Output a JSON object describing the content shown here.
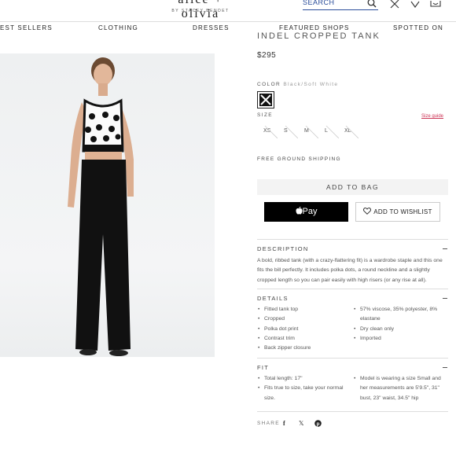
{
  "header": {
    "logo": "alice + olivia",
    "logo_sub": "BY STACEY BENDET",
    "search_placeholder": "SEARCH",
    "nav": [
      "EST SELLERS",
      "CLOTHING",
      "DRESSES",
      "FEATURED SHOPS",
      "SPOTTED ON"
    ]
  },
  "product": {
    "title": "INDEL CROPPED TANK",
    "price": "$295",
    "color_label": "COLOR",
    "color_value": "Black/Soft White",
    "size_label": "SIZE",
    "size_guide": "Size guide",
    "sizes": [
      "XS",
      "S",
      "M",
      "L",
      "XL"
    ],
    "shipping": "FREE GROUND SHIPPING",
    "add_to_bag": "ADD TO BAG",
    "apple_pay": "Pay",
    "wishlist": "ADD TO WISHLIST"
  },
  "description": {
    "heading": "DESCRIPTION",
    "text": "A bold, ribbed tank (with a crazy-flattering fit) is a wardrobe staple and this one fits the bill perfectly. It includes polka dots, a round neckline and a slightly cropped length so you can pair easily with high risers (or any rise at all)."
  },
  "details": {
    "heading": "DETAILS",
    "left": [
      "Fitted tank top",
      "Cropped",
      "Polka dot print",
      "Contrast trim",
      "Back zipper closure"
    ],
    "right": [
      "57% viscose, 35% polyester, 8% elastane",
      "Dry clean only",
      "Imported"
    ]
  },
  "fit": {
    "heading": "FIT",
    "left": [
      "Total length: 17\"",
      "Fits true to size, take your normal size."
    ],
    "right": [
      "Model is wearing a size Small and her measurements are 5'9.5\", 31\" bust, 23\" waist, 34.5\" hip"
    ]
  },
  "share": {
    "label": "SHARE",
    "icons": [
      "facebook-icon",
      "x-icon",
      "pinterest-icon"
    ]
  },
  "colors": {
    "accent_link": "#cc3355",
    "search_blue": "#2a4d9a",
    "button_black": "#000000"
  }
}
